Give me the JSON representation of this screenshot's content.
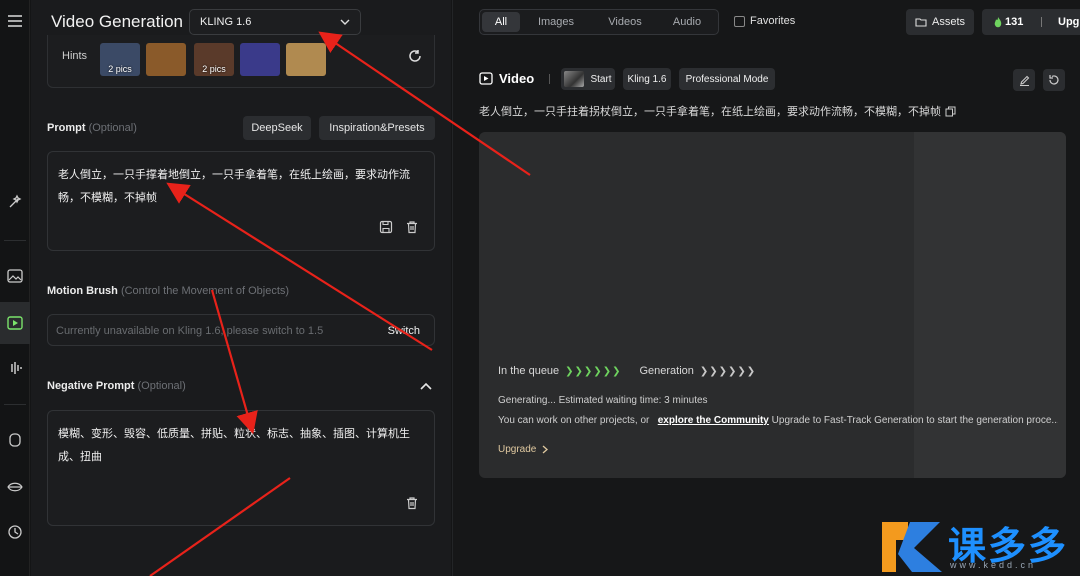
{
  "header": {
    "title": "Video Generation",
    "model": "KLING 1.6"
  },
  "hints": {
    "label": "Hints",
    "thumbs": [
      {
        "badge": "2 pics",
        "color": "#3b4a66"
      },
      {
        "badge": "",
        "color": "#8a5a2a"
      },
      {
        "badge": "2 pics",
        "color": "#5a3a2a"
      },
      {
        "badge": "",
        "color": "#3a3a8a"
      },
      {
        "badge": "",
        "color": "#b08a50"
      }
    ]
  },
  "prompt": {
    "label": "Prompt",
    "optional": "(Optional)",
    "deepseek": "DeepSeek",
    "presets": "Inspiration&Presets",
    "text": "老人倒立，一只手撑着地倒立，一只手拿着笔，在纸上绘画，要求动作流畅，不模糊，不掉帧"
  },
  "motion": {
    "label": "Motion Brush",
    "hint": "(Control the Movement of Objects)",
    "placeholder": "Currently unavailable on Kling 1.6, please switch to 1.5",
    "switch": "Switch"
  },
  "negative": {
    "label": "Negative Prompt",
    "optional": "(Optional)",
    "text": "模糊、变形、毁容、低质量、拼贴、粒状、标志、抽象、插图、计算机生成、扭曲"
  },
  "filters": {
    "tabs": [
      "All",
      "Images",
      "Videos",
      "Audio"
    ],
    "selected": "All",
    "favorites": "Favorites"
  },
  "account": {
    "assets": "Assets",
    "credits": "131",
    "upgrade": "Upg"
  },
  "video": {
    "title": "Video",
    "chips": [
      "Start",
      "Kling 1.6",
      "Professional Mode"
    ],
    "prompt": "老人倒立，一只手拄着拐杖倒立，一只手拿着笔，在纸上绘画，要求动作流畅，不模糊，不掉帧"
  },
  "generation": {
    "queue": "In the queue",
    "queue_arrows": "❯❯❯❯❯❯",
    "gen": "Generation",
    "gen_arrows": "❯❯❯❯❯❯",
    "status": "Generating... Estimated waiting time: 3 minutes",
    "note_pre": "You can work on other projects, or",
    "note_link": "explore the Community",
    "note_post": "Upgrade to Fast-Track Generation to start the generation proce...",
    "upgrade": "Upgrade"
  },
  "watermark": {
    "text": "课多多",
    "url": "www.kedd.cn"
  }
}
